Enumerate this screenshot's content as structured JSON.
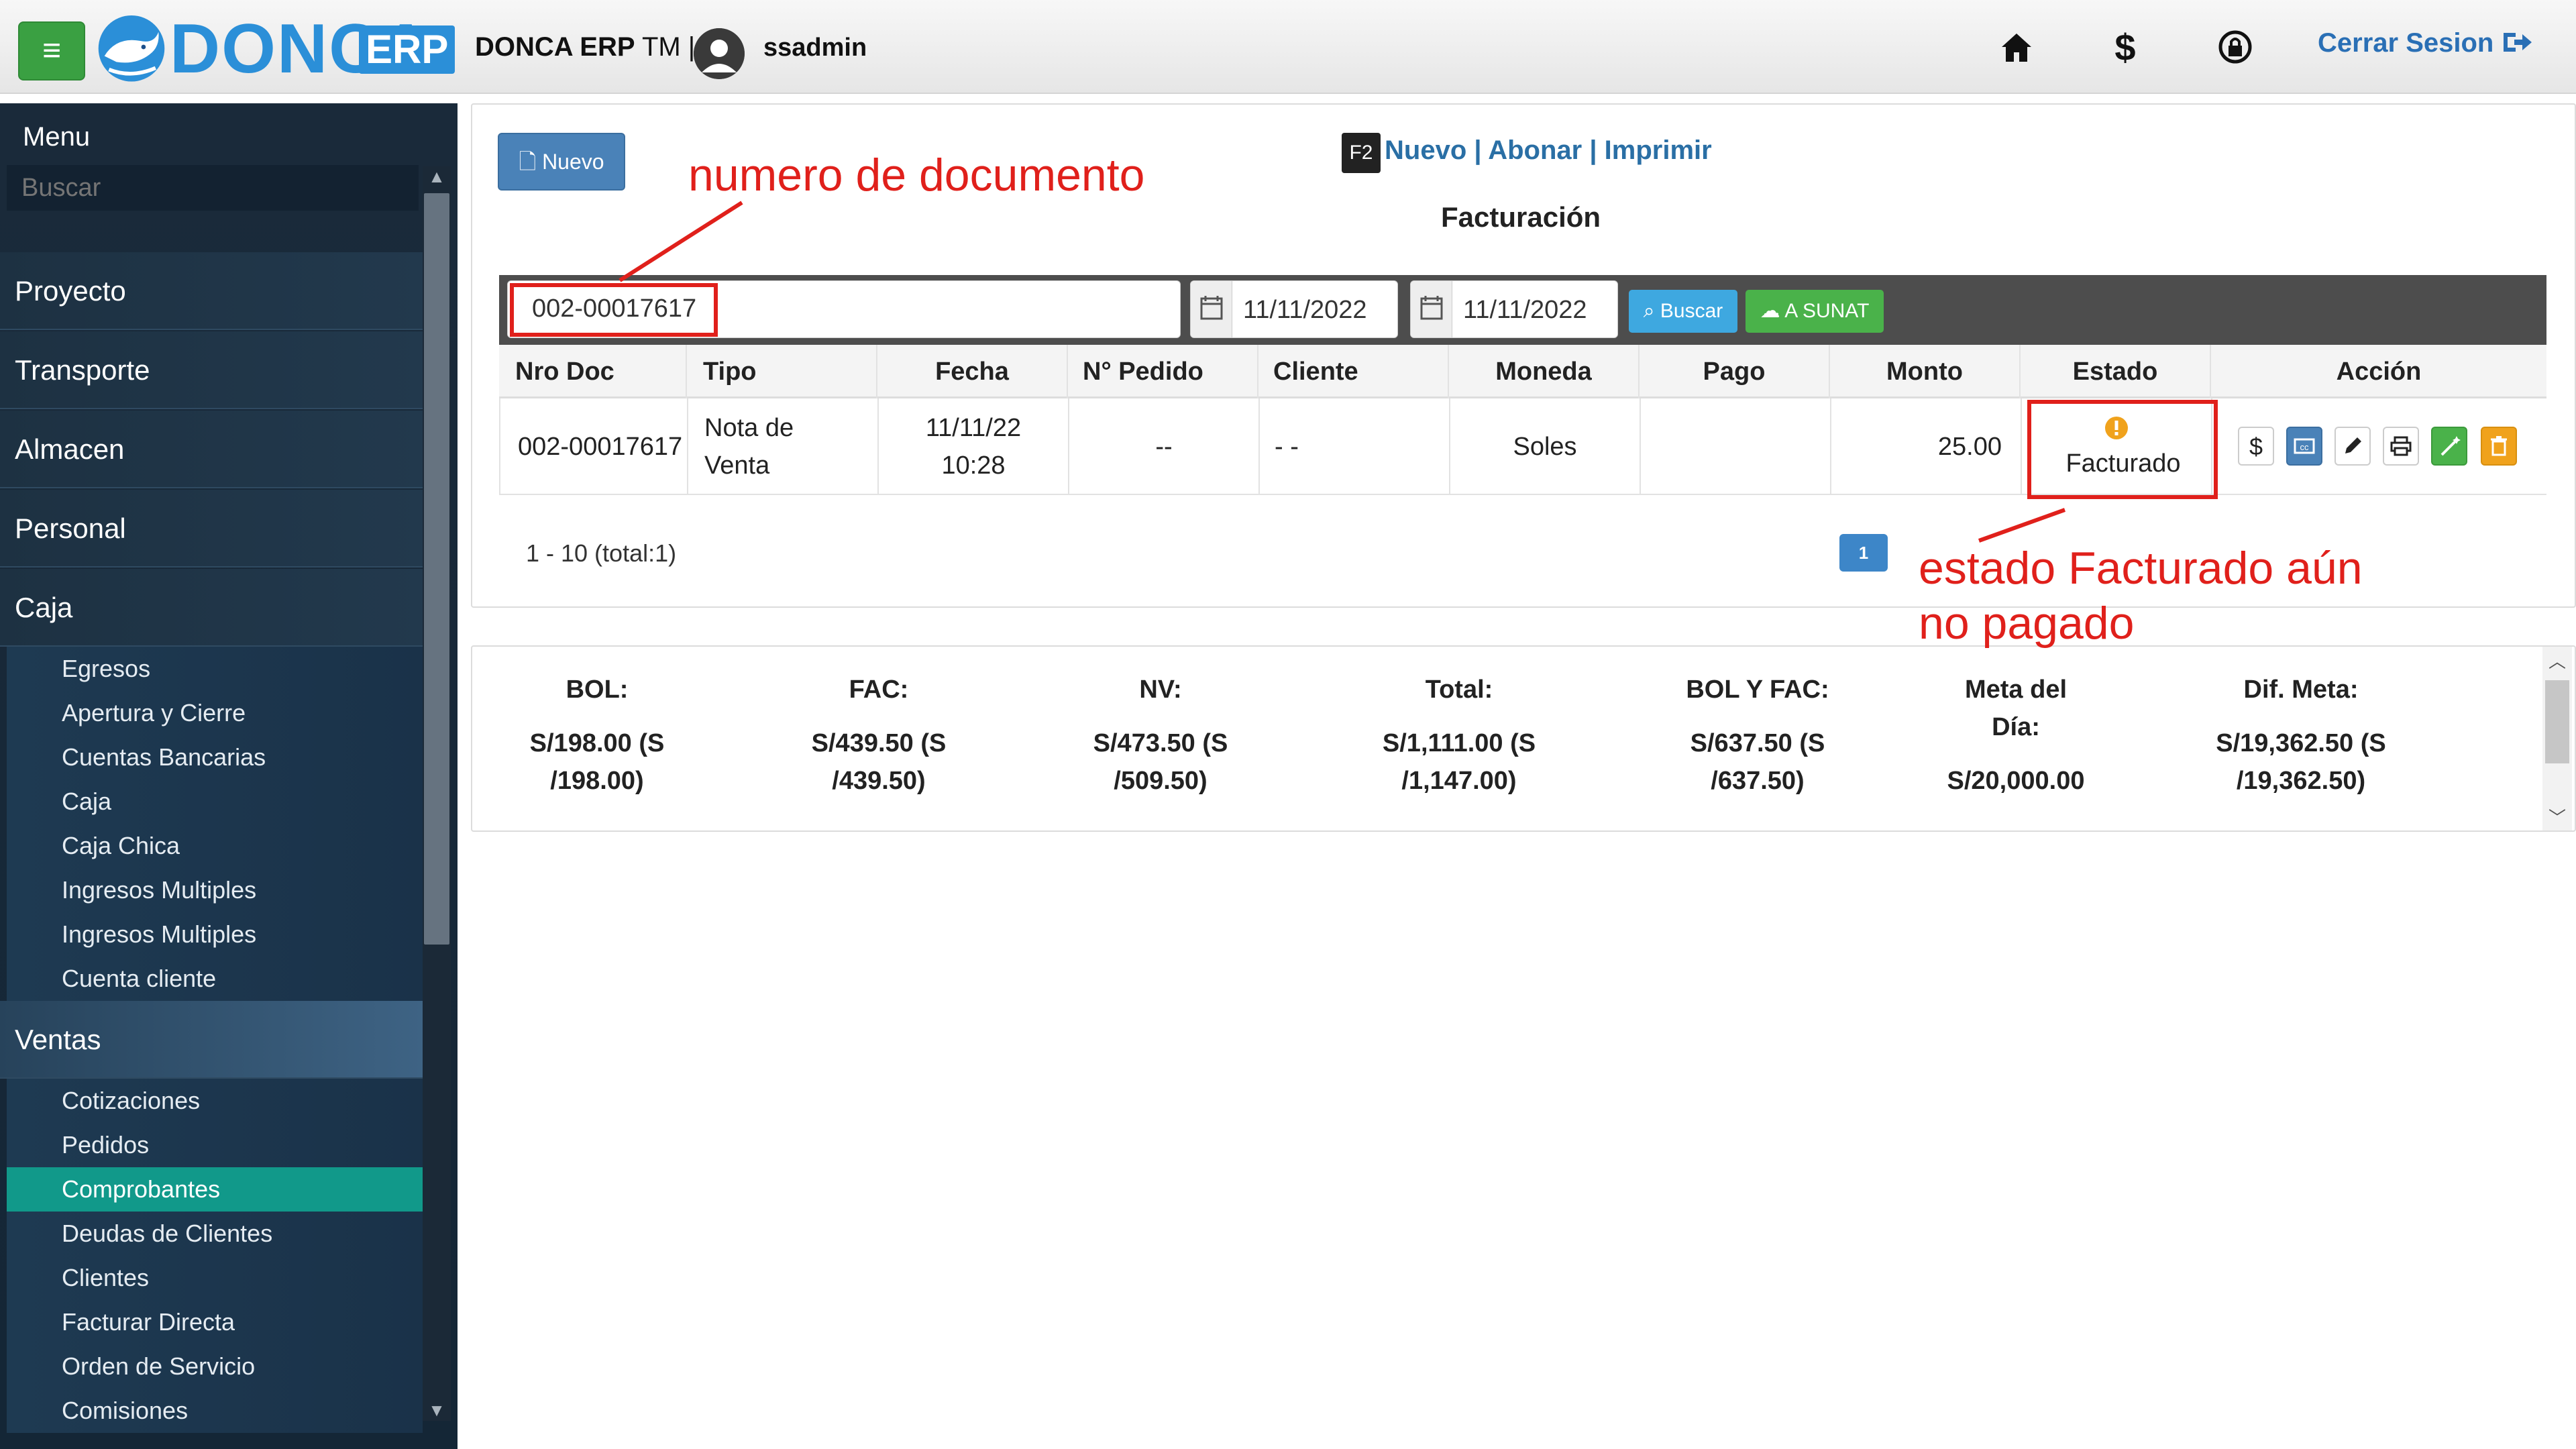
{
  "topbar": {
    "logo_text": "DONCA",
    "logo_badge": "ERP",
    "app_name": "DONCA ERP",
    "app_suffix": "TM |",
    "username": "ssadmin",
    "logout_label": "Cerrar Sesion",
    "icons": [
      "home-icon",
      "dollar-icon",
      "lock-refresh-icon",
      "logout-icon"
    ]
  },
  "sidebar": {
    "title": "Menu",
    "search_placeholder": "Buscar",
    "sections": [
      {
        "label": "Proyecto"
      },
      {
        "label": "Transporte"
      },
      {
        "label": "Almacen"
      },
      {
        "label": "Personal"
      },
      {
        "label": "Caja"
      }
    ],
    "caja_items": [
      "Egresos",
      "Apertura y Cierre",
      "Cuentas Bancarias",
      "Caja",
      "Caja Chica",
      "Ingresos Multiples",
      "Ingresos Multiples",
      "Cuenta cliente"
    ],
    "ventas_label": "Ventas",
    "ventas_items": [
      "Cotizaciones",
      "Pedidos",
      "Comprobantes",
      "Deudas de Clientes",
      "Clientes",
      "Facturar Directa",
      "Orden de Servicio",
      "Comisiones"
    ],
    "active_item": "Comprobantes"
  },
  "main": {
    "new_button": "Nuevo",
    "shortcut_key": "F2",
    "links": [
      "Nuevo",
      "Abonar",
      "Imprimir"
    ],
    "title": "Facturación",
    "search": {
      "doc_number": "002-00017617",
      "date_from": "11/11/2022",
      "date_to": "11/11/2022",
      "search_button": "Buscar",
      "sunat_button": "A SUNAT"
    },
    "table": {
      "headers": [
        "Nro Doc",
        "Tipo",
        "Fecha",
        "N° Pedido",
        "Cliente",
        "Moneda",
        "Pago",
        "Monto",
        "Estado",
        "Acción"
      ],
      "rows": [
        {
          "nro_doc": "002-00017617",
          "tipo_line1": "Nota de",
          "tipo_line2": "Venta",
          "fecha_line1": "11/11/22",
          "fecha_line2": "10:28",
          "pedido": "--",
          "cliente": "- -",
          "moneda": "Soles",
          "pago": "",
          "monto": "25.00",
          "estado": "Facturado"
        }
      ]
    },
    "pager_text": "1 - 10 (total:1)",
    "current_page": "1"
  },
  "summary": [
    {
      "label": "BOL:",
      "line1": "S/198.00 (S",
      "line2": "/198.00)"
    },
    {
      "label": "FAC:",
      "line1": "S/439.50 (S",
      "line2": "/439.50)"
    },
    {
      "label": "NV:",
      "line1": "S/473.50 (S",
      "line2": "/509.50)"
    },
    {
      "label": "Total:",
      "line1": "S/1,111.00 (S",
      "line2": "/1,147.00)"
    },
    {
      "label": "BOL Y FAC:",
      "line1": "S/637.50 (S",
      "line2": "/637.50)"
    },
    {
      "label": "Meta del",
      "label2": "Día:",
      "line1": "S/20,000.00",
      "line2": ""
    },
    {
      "label": "Dif. Meta:",
      "line1": "S/19,362.50 (S",
      "line2": "/19,362.50)"
    }
  ],
  "annotations": {
    "doc_note": "numero de documento",
    "estado_note_line1": "estado Facturado aún",
    "estado_note_line2": "no pagado"
  },
  "colors": {
    "accent_blue": "#2b8fd8",
    "active_teal": "#11998a",
    "annotation_red": "#e0201b",
    "menu_green": "#3aa042"
  }
}
